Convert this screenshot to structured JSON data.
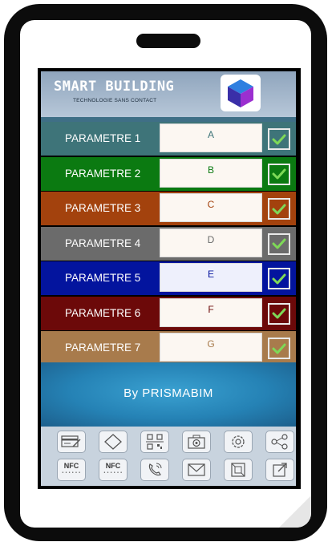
{
  "app": {
    "title": "SMART BUILDING",
    "subtitle": "TECHNOLOGIE SANS CONTACT",
    "logo_icon": "cube-icon"
  },
  "rows": [
    {
      "label": "PARAMETRE 1",
      "value": "A",
      "bg": "#3e7479",
      "text_color": "#3e7479",
      "input_bg": "#fcf7f2",
      "check_bg": "#3e7479"
    },
    {
      "label": "PARAMETRE 2",
      "value": "B",
      "bg": "#0b7a11",
      "text_color": "#0b7a11",
      "input_bg": "#fcf7f2",
      "check_bg": "#0b7a11"
    },
    {
      "label": "PARAMETRE 3",
      "value": "C",
      "bg": "#a3420d",
      "text_color": "#a3420d",
      "input_bg": "#fcf7f2",
      "check_bg": "#a3420d"
    },
    {
      "label": "PARAMETRE 4",
      "value": "D",
      "bg": "#6b6b6b",
      "text_color": "#6b6b6b",
      "input_bg": "#fcf7f2",
      "check_bg": "#6b6b6b"
    },
    {
      "label": "PARAMETRE 5",
      "value": "E",
      "bg": "#03149e",
      "text_color": "#03149e",
      "input_bg": "#eef0fc",
      "check_bg": "#03149e"
    },
    {
      "label": "PARAMETRE 6",
      "value": "F",
      "bg": "#6c0909",
      "text_color": "#6c0909",
      "input_bg": "#fcf7f2",
      "check_bg": "#6c0909"
    },
    {
      "label": "PARAMETRE 7",
      "value": "G",
      "bg": "#a87b4c",
      "text_color": "#a87b4c",
      "input_bg": "#fcf7f2",
      "check_bg": "#a87b4c"
    }
  ],
  "footer": {
    "text": "By  PRISMABIM"
  },
  "toolbar": {
    "row1": [
      "card-edit-icon",
      "eraser-icon",
      "qr-code-icon",
      "camera-icon",
      "settings-icon",
      "share-icon"
    ],
    "row2": [
      "nfc-read-icon",
      "nfc-write-icon",
      "phone-call-icon",
      "mail-icon",
      "box-3d-icon",
      "export-icon"
    ],
    "nfc_read": {
      "label": "NFC",
      "sub": "• • • • • •"
    },
    "nfc_write": {
      "label": "NFC",
      "sub": "• • • • • •"
    }
  },
  "colors": {
    "header_bg": "#a7b8ca",
    "footer_bg": "#2a88bb",
    "toolbar_bg": "#c8d3de",
    "check_mark": "#7ed957"
  }
}
